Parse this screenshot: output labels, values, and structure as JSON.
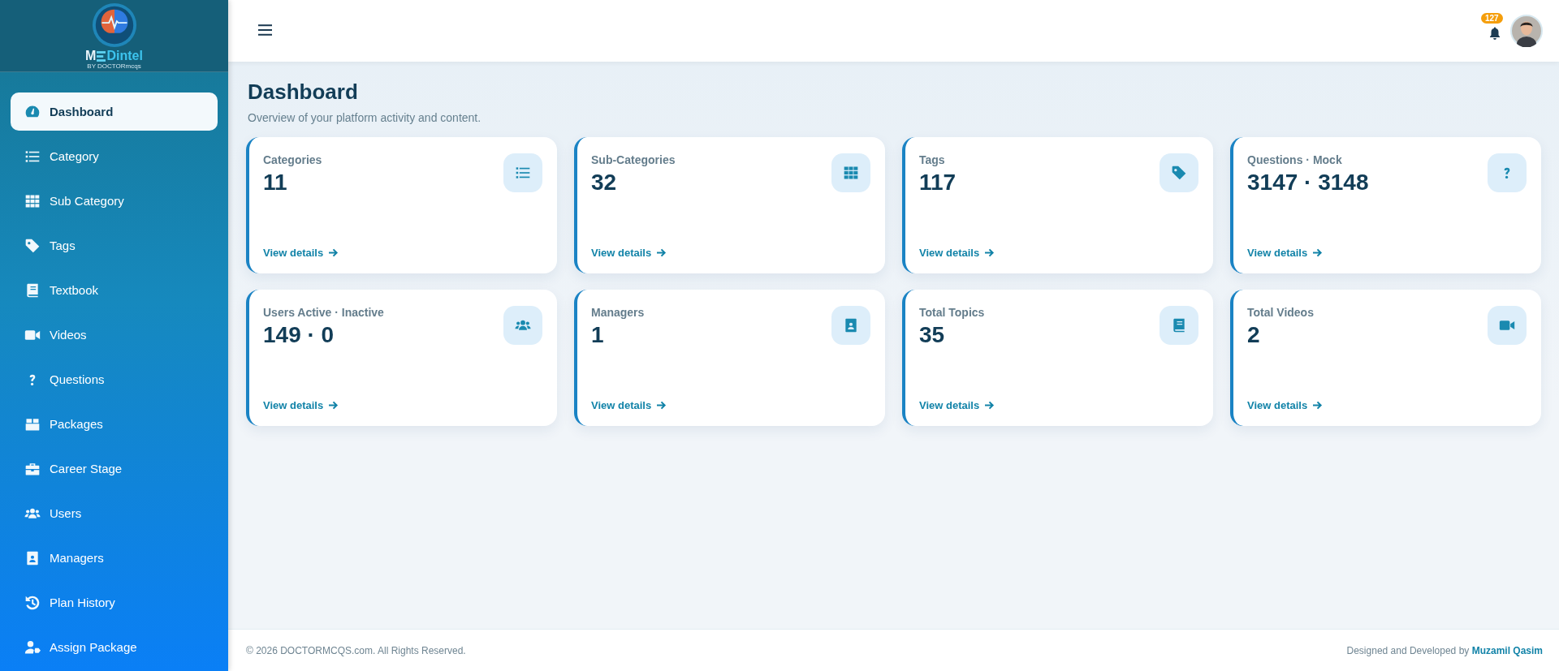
{
  "logo": {
    "text_start": "M",
    "text_end": "Dintel",
    "tagline": "BY DOCTORmcqs"
  },
  "sidebar": {
    "items": [
      {
        "label": "Dashboard",
        "kind": "gauge",
        "selected": true
      },
      {
        "label": "Category",
        "kind": "list",
        "selected": false
      },
      {
        "label": "Sub Category",
        "kind": "grid",
        "selected": false
      },
      {
        "label": "Tags",
        "kind": "tag",
        "selected": false
      },
      {
        "label": "Textbook",
        "kind": "book",
        "selected": false
      },
      {
        "label": "Videos",
        "kind": "video",
        "selected": false
      },
      {
        "label": "Questions",
        "kind": "question",
        "selected": false
      },
      {
        "label": "Packages",
        "kind": "box",
        "selected": false
      },
      {
        "label": "Career Stage",
        "kind": "briefcase",
        "selected": false
      },
      {
        "label": "Users",
        "kind": "users",
        "selected": false
      },
      {
        "label": "Managers",
        "kind": "badge",
        "selected": false
      },
      {
        "label": "Plan History",
        "kind": "history",
        "selected": false
      },
      {
        "label": "Assign Package",
        "kind": "usertag",
        "selected": false
      }
    ]
  },
  "header": {
    "notifications": "127"
  },
  "page": {
    "title": "Dashboard",
    "subtitle": "Overview of your platform activity and content."
  },
  "cards": [
    {
      "label": "Categories",
      "value": "11",
      "kind": "list",
      "link": "View details"
    },
    {
      "label": "Sub-Categories",
      "value": "32",
      "kind": "grid",
      "link": "View details"
    },
    {
      "label": "Tags",
      "value": "117",
      "kind": "tag",
      "link": "View details"
    },
    {
      "label": "Questions · Mock",
      "value": "3147 · 3148",
      "kind": "question",
      "link": "View details"
    },
    {
      "label": "Users Active · Inactive",
      "value": "149 · 0",
      "kind": "users",
      "link": "View details"
    },
    {
      "label": "Managers",
      "value": "1",
      "kind": "badge",
      "link": "View details"
    },
    {
      "label": "Total Topics",
      "value": "35",
      "kind": "book",
      "link": "View details"
    },
    {
      "label": "Total Videos",
      "value": "2",
      "kind": "video",
      "link": "View details"
    }
  ],
  "footer": {
    "copyright": "© 2026 DOCTORMCQS.com. All Rights Reserved.",
    "credit": "Designed and Developed by **Muzamil Qasim**"
  }
}
